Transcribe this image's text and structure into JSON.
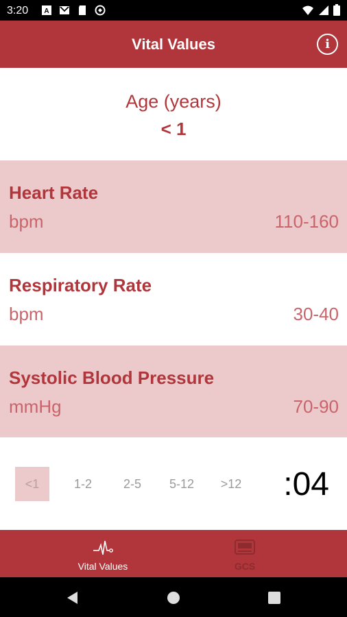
{
  "status_bar": {
    "time": "3:20"
  },
  "app_bar": {
    "title": "Vital Values"
  },
  "age": {
    "label": "Age (years)",
    "value": "< 1"
  },
  "vitals": [
    {
      "title": "Heart Rate",
      "unit": "bpm",
      "range": "110-160"
    },
    {
      "title": "Respiratory Rate",
      "unit": "bpm",
      "range": "30-40"
    },
    {
      "title": "Systolic Blood Pressure",
      "unit": "mmHg",
      "range": "70-90"
    }
  ],
  "age_selector": {
    "options": [
      "<1",
      "1-2",
      "2-5",
      "5-12",
      ">12"
    ],
    "selected": "<1"
  },
  "timer": ":04",
  "bottom_nav": {
    "items": [
      {
        "label": "Vital Values",
        "icon": "heartbeat-icon",
        "active": true
      },
      {
        "label": "GCS",
        "icon": "gcs-icon",
        "active": false
      }
    ]
  },
  "colors": {
    "primary": "#b0363b",
    "shaded_row": "#ecc9cb",
    "muted_text": "#c9646a"
  }
}
